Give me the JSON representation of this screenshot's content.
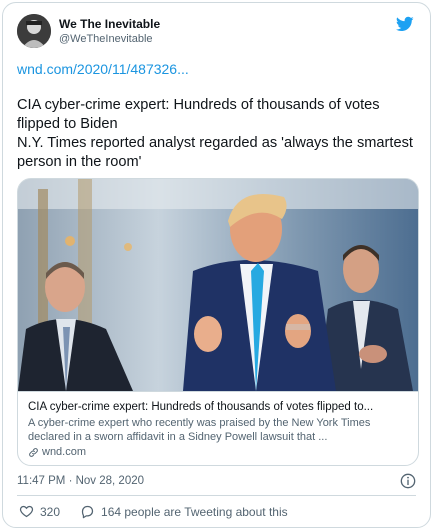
{
  "author": {
    "name": "We The Inevitable",
    "handle": "@WeTheInevitable"
  },
  "icons": {
    "brand": "twitter-bird-icon",
    "info": "info-icon",
    "like": "heart-icon",
    "reply": "speech-bubble-icon",
    "link": "link-icon"
  },
  "colors": {
    "twitter_blue": "#1da1f2",
    "link_blue": "#1b95e0",
    "secondary_text": "#536471"
  },
  "tweet": {
    "link": "wnd.com/2020/11/487326...",
    "text": "CIA cyber-crime expert: Hundreds of thousands of votes flipped to Biden\nN.Y. Times reported analyst regarded as 'always the smartest person in the room'",
    "timestamp": "11:47 PM · Nov 28, 2020"
  },
  "preview": {
    "title": "CIA cyber-crime expert: Hundreds of thousands of votes flipped to...",
    "description": "A cyber-crime expert who recently was praised by the New York Times declared in a sworn affidavit in a Sidney Powell lawsuit that ...",
    "domain": "wnd.com"
  },
  "actions": {
    "like_count": "320",
    "reply_text": "164 people are Tweeting about this"
  }
}
